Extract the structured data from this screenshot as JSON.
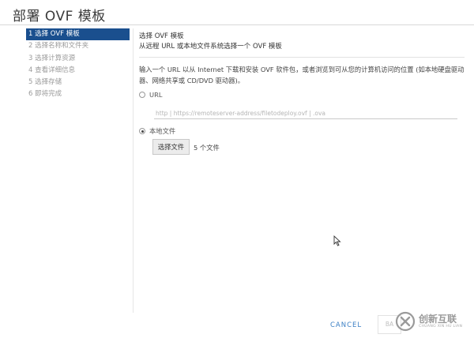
{
  "window": {
    "title": "部署 OVF 模板"
  },
  "steps": [
    {
      "label": "1 选择 OVF 模板",
      "active": true
    },
    {
      "label": "2 选择名称和文件夹"
    },
    {
      "label": "3 选择计算资源"
    },
    {
      "label": "4 查看详细信息"
    },
    {
      "label": "5 选择存储"
    },
    {
      "label": "6 即将完成"
    }
  ],
  "main": {
    "heading": "选择 OVF 模板",
    "subheading": "从远程 URL 或本地文件系统选择一个 OVF 模板",
    "description": "输入一个 URL 以从 Internet 下载和安装 OVF 软件包，或者浏览到可从您的计算机访问的位置 (如本地硬盘驱动器、网络共享或 CD/DVD 驱动器)。",
    "url_option": {
      "label": "URL",
      "checked": false
    },
    "url_placeholder": "http | https://remoteserver-address/filetodeploy.ovf | .ova",
    "local_option": {
      "label": "本地文件",
      "checked": true
    },
    "choose_file_label": "选择文件",
    "file_count": "5 个文件"
  },
  "footer": {
    "cancel_label": "CANCEL",
    "next_label": "BA"
  },
  "watermark": {
    "text": "创新互联",
    "subtext": "CHUANG XIN HU LIAN"
  }
}
